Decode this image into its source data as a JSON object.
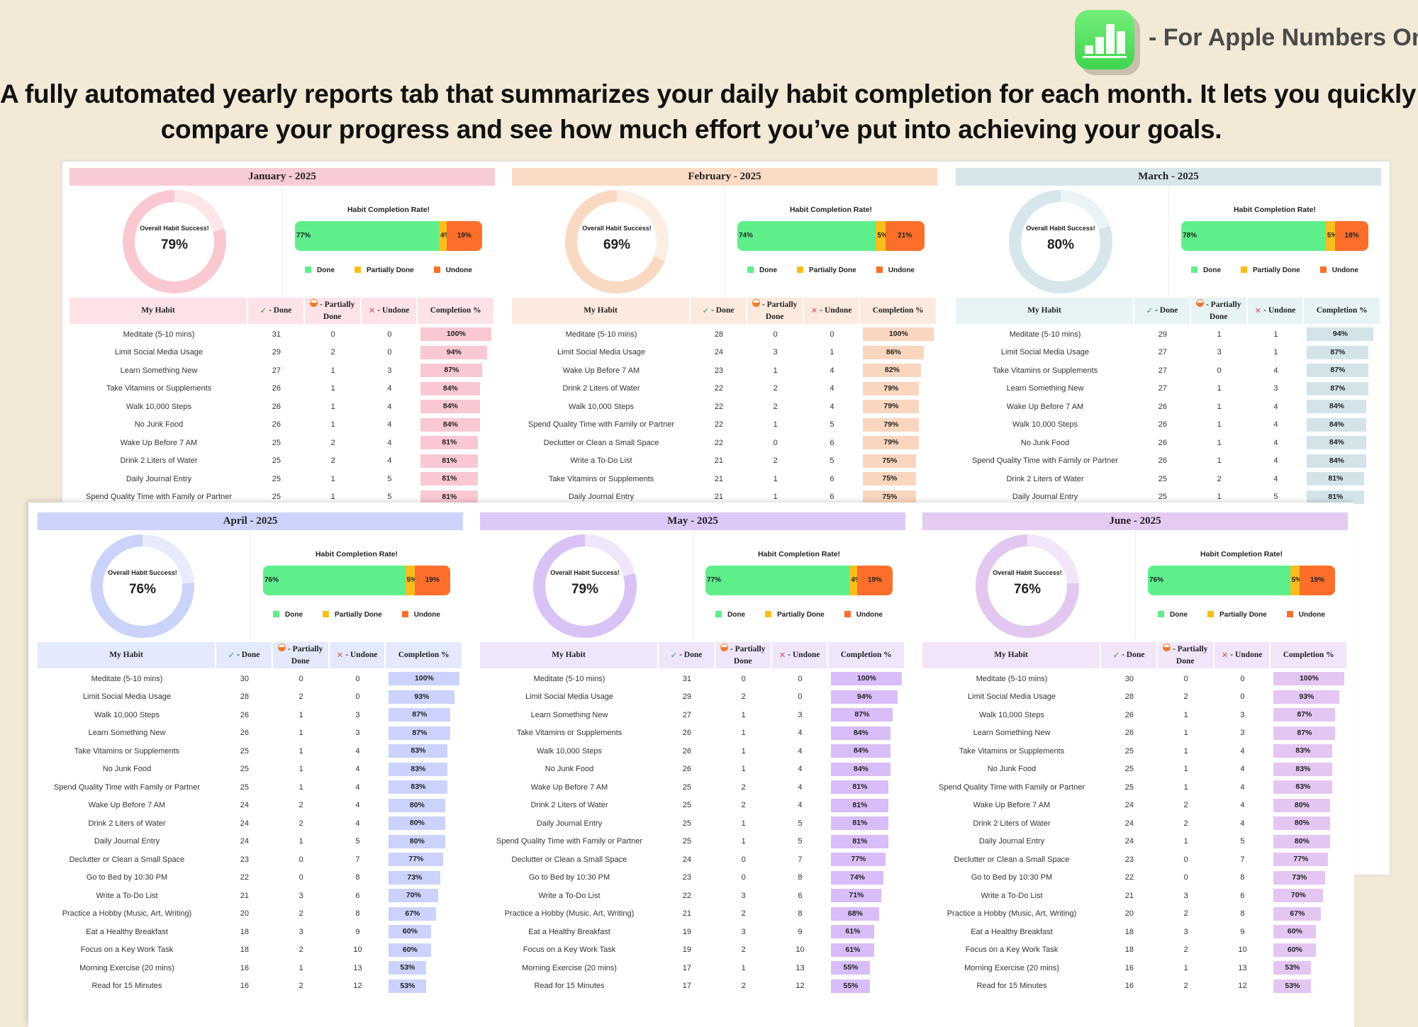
{
  "brand": {
    "icon": "apple-numbers-icon",
    "tagline": "- For Apple Numbers Only"
  },
  "headline": {
    "line1": "A fully automated yearly reports tab that summarizes your daily habit completion for each month. It lets you quickly",
    "line2": "compare your progress and see how much effort you’ve put into achieving your goals."
  },
  "labels": {
    "overall": "Overall Habit Success!",
    "rate_title": "Habit Completion Rate!",
    "legend_done": "Done",
    "legend_partial": "Partially Done",
    "legend_undone": "Undone",
    "col_habit": "My Habit",
    "col_done": "- Done",
    "col_partial": "- Partially Done",
    "col_undone": "- Undone",
    "col_completion": "Completion %"
  },
  "colors": {
    "done": "#5eef8b",
    "partial": "#f8be1c",
    "undone": "#fb6f2b"
  },
  "months": [
    {
      "title": "January - 2025",
      "overall": "79%",
      "done": "77%",
      "partial": "4%",
      "undone": "19%",
      "theme": {
        "head": "#f9ccd5",
        "th": "#fde3e8",
        "bar": "#f9c8d2",
        "ring": "#f9c8d1",
        "ring_light": "#fde6ea"
      },
      "rows": [
        {
          "habit": "Meditate (5-10 mins)",
          "done": "31",
          "partial": "0",
          "undone": "0",
          "pct": "100%"
        },
        {
          "habit": "Limit Social Media Usage",
          "done": "29",
          "partial": "2",
          "undone": "0",
          "pct": "94%"
        },
        {
          "habit": "Learn Something New",
          "done": "27",
          "partial": "1",
          "undone": "3",
          "pct": "87%"
        },
        {
          "habit": "Take Vitamins or Supplements",
          "done": "26",
          "partial": "1",
          "undone": "4",
          "pct": "84%"
        },
        {
          "habit": "Walk 10,000 Steps",
          "done": "26",
          "partial": "1",
          "undone": "4",
          "pct": "84%"
        },
        {
          "habit": "No Junk Food",
          "done": "26",
          "partial": "1",
          "undone": "4",
          "pct": "84%"
        },
        {
          "habit": "Wake Up Before 7 AM",
          "done": "25",
          "partial": "2",
          "undone": "4",
          "pct": "81%"
        },
        {
          "habit": "Drink 2 Liters of Water",
          "done": "25",
          "partial": "2",
          "undone": "4",
          "pct": "81%"
        },
        {
          "habit": "Daily Journal Entry",
          "done": "25",
          "partial": "1",
          "undone": "5",
          "pct": "81%"
        },
        {
          "habit": "Spend Quality Time with Family or Partner",
          "done": "25",
          "partial": "1",
          "undone": "5",
          "pct": "81%"
        }
      ]
    },
    {
      "title": "February - 2025",
      "overall": "69%",
      "done": "74%",
      "partial": "5%",
      "undone": "21%",
      "theme": {
        "head": "#fbdbc6",
        "th": "#fdeadf",
        "bar": "#fad6bf",
        "ring": "#fad9c3",
        "ring_light": "#fdeee4"
      },
      "rows": [
        {
          "habit": "Meditate (5-10 mins)",
          "done": "28",
          "partial": "0",
          "undone": "0",
          "pct": "100%"
        },
        {
          "habit": "Limit Social Media Usage",
          "done": "24",
          "partial": "3",
          "undone": "1",
          "pct": "86%"
        },
        {
          "habit": "Wake Up Before 7 AM",
          "done": "23",
          "partial": "1",
          "undone": "4",
          "pct": "82%"
        },
        {
          "habit": "Drink 2 Liters of Water",
          "done": "22",
          "partial": "2",
          "undone": "4",
          "pct": "79%"
        },
        {
          "habit": "Walk 10,000 Steps",
          "done": "22",
          "partial": "2",
          "undone": "4",
          "pct": "79%"
        },
        {
          "habit": "Spend Quality Time with Family or Partner",
          "done": "22",
          "partial": "1",
          "undone": "5",
          "pct": "79%"
        },
        {
          "habit": "Declutter or Clean a Small Space",
          "done": "22",
          "partial": "0",
          "undone": "6",
          "pct": "79%"
        },
        {
          "habit": "Write a To-Do List",
          "done": "21",
          "partial": "2",
          "undone": "5",
          "pct": "75%"
        },
        {
          "habit": "Take Vitamins or Supplements",
          "done": "21",
          "partial": "1",
          "undone": "6",
          "pct": "75%"
        },
        {
          "habit": "Daily Journal Entry",
          "done": "21",
          "partial": "1",
          "undone": "6",
          "pct": "75%"
        }
      ]
    },
    {
      "title": "March - 2025",
      "overall": "80%",
      "done": "78%",
      "partial": "5%",
      "undone": "18%",
      "theme": {
        "head": "#d7e6eb",
        "th": "#e8f3f6",
        "bar": "#d3e4e9",
        "ring": "#d6e6eb",
        "ring_light": "#eaf4f6"
      },
      "rows": [
        {
          "habit": "Meditate (5-10 mins)",
          "done": "29",
          "partial": "1",
          "undone": "1",
          "pct": "94%"
        },
        {
          "habit": "Limit Social Media Usage",
          "done": "27",
          "partial": "3",
          "undone": "1",
          "pct": "87%"
        },
        {
          "habit": "Take Vitamins or Supplements",
          "done": "27",
          "partial": "0",
          "undone": "4",
          "pct": "87%"
        },
        {
          "habit": "Learn Something New",
          "done": "27",
          "partial": "1",
          "undone": "3",
          "pct": "87%"
        },
        {
          "habit": "Wake Up Before 7 AM",
          "done": "26",
          "partial": "1",
          "undone": "4",
          "pct": "84%"
        },
        {
          "habit": "Walk 10,000 Steps",
          "done": "26",
          "partial": "1",
          "undone": "4",
          "pct": "84%"
        },
        {
          "habit": "No Junk Food",
          "done": "26",
          "partial": "1",
          "undone": "4",
          "pct": "84%"
        },
        {
          "habit": "Spend Quality Time with Family or Partner",
          "done": "26",
          "partial": "1",
          "undone": "4",
          "pct": "84%"
        },
        {
          "habit": "Drink 2 Liters of Water",
          "done": "25",
          "partial": "2",
          "undone": "4",
          "pct": "81%"
        },
        {
          "habit": "Daily Journal Entry",
          "done": "25",
          "partial": "1",
          "undone": "5",
          "pct": "81%"
        }
      ]
    },
    {
      "title": "April - 2025",
      "overall": "76%",
      "done": "76%",
      "partial": "5%",
      "undone": "19%",
      "theme": {
        "head": "#cdd3fb",
        "th": "#e5e9fd",
        "bar": "#ccd2fb",
        "ring": "#ccd3fa",
        "ring_light": "#e8ebfd"
      },
      "rows": [
        {
          "habit": "Meditate (5-10 mins)",
          "done": "30",
          "partial": "0",
          "undone": "0",
          "pct": "100%"
        },
        {
          "habit": "Limit Social Media Usage",
          "done": "28",
          "partial": "2",
          "undone": "0",
          "pct": "93%"
        },
        {
          "habit": "Walk 10,000 Steps",
          "done": "26",
          "partial": "1",
          "undone": "3",
          "pct": "87%"
        },
        {
          "habit": "Learn Something New",
          "done": "26",
          "partial": "1",
          "undone": "3",
          "pct": "87%"
        },
        {
          "habit": "Take Vitamins or Supplements",
          "done": "25",
          "partial": "1",
          "undone": "4",
          "pct": "83%"
        },
        {
          "habit": "No Junk Food",
          "done": "25",
          "partial": "1",
          "undone": "4",
          "pct": "83%"
        },
        {
          "habit": "Spend Quality Time with Family or Partner",
          "done": "25",
          "partial": "1",
          "undone": "4",
          "pct": "83%"
        },
        {
          "habit": "Wake Up Before 7 AM",
          "done": "24",
          "partial": "2",
          "undone": "4",
          "pct": "80%"
        },
        {
          "habit": "Drink 2 Liters of Water",
          "done": "24",
          "partial": "2",
          "undone": "4",
          "pct": "80%"
        },
        {
          "habit": "Daily Journal Entry",
          "done": "24",
          "partial": "1",
          "undone": "5",
          "pct": "80%"
        },
        {
          "habit": "Declutter or Clean a Small Space",
          "done": "23",
          "partial": "0",
          "undone": "7",
          "pct": "77%"
        },
        {
          "habit": "Go to Bed by 10:30 PM",
          "done": "22",
          "partial": "0",
          "undone": "8",
          "pct": "73%"
        },
        {
          "habit": "Write a To-Do List",
          "done": "21",
          "partial": "3",
          "undone": "6",
          "pct": "70%"
        },
        {
          "habit": "Practice a Hobby (Music, Art, Writing)",
          "done": "20",
          "partial": "2",
          "undone": "8",
          "pct": "67%"
        },
        {
          "habit": "Eat a Healthy Breakfast",
          "done": "18",
          "partial": "3",
          "undone": "9",
          "pct": "60%"
        },
        {
          "habit": "Focus on a Key Work Task",
          "done": "18",
          "partial": "2",
          "undone": "10",
          "pct": "60%"
        },
        {
          "habit": "Morning Exercise (20 mins)",
          "done": "16",
          "partial": "1",
          "undone": "13",
          "pct": "53%"
        },
        {
          "habit": "Read for 15 Minutes",
          "done": "16",
          "partial": "2",
          "undone": "12",
          "pct": "53%"
        }
      ]
    },
    {
      "title": "May - 2025",
      "overall": "79%",
      "done": "77%",
      "partial": "4%",
      "undone": "19%",
      "theme": {
        "head": "#dcc9f8",
        "th": "#efe6fc",
        "bar": "#d8bdf8",
        "ring": "#d9c3f6",
        "ring_light": "#efe6fc"
      },
      "rows": [
        {
          "habit": "Meditate (5-10 mins)",
          "done": "31",
          "partial": "0",
          "undone": "0",
          "pct": "100%"
        },
        {
          "habit": "Limit Social Media Usage",
          "done": "29",
          "partial": "2",
          "undone": "0",
          "pct": "94%"
        },
        {
          "habit": "Learn Something New",
          "done": "27",
          "partial": "1",
          "undone": "3",
          "pct": "87%"
        },
        {
          "habit": "Take Vitamins or Supplements",
          "done": "26",
          "partial": "1",
          "undone": "4",
          "pct": "84%"
        },
        {
          "habit": "Walk 10,000 Steps",
          "done": "26",
          "partial": "1",
          "undone": "4",
          "pct": "84%"
        },
        {
          "habit": "No Junk Food",
          "done": "26",
          "partial": "1",
          "undone": "4",
          "pct": "84%"
        },
        {
          "habit": "Wake Up Before 7 AM",
          "done": "25",
          "partial": "2",
          "undone": "4",
          "pct": "81%"
        },
        {
          "habit": "Drink 2 Liters of Water",
          "done": "25",
          "partial": "2",
          "undone": "4",
          "pct": "81%"
        },
        {
          "habit": "Daily Journal Entry",
          "done": "25",
          "partial": "1",
          "undone": "5",
          "pct": "81%"
        },
        {
          "habit": "Spend Quality Time with Family or Partner",
          "done": "25",
          "partial": "1",
          "undone": "5",
          "pct": "81%"
        },
        {
          "habit": "Declutter or Clean a Small Space",
          "done": "24",
          "partial": "0",
          "undone": "7",
          "pct": "77%"
        },
        {
          "habit": "Go to Bed by 10:30 PM",
          "done": "23",
          "partial": "0",
          "undone": "8",
          "pct": "74%"
        },
        {
          "habit": "Write a To-Do List",
          "done": "22",
          "partial": "3",
          "undone": "6",
          "pct": "71%"
        },
        {
          "habit": "Practice a Hobby (Music, Art, Writing)",
          "done": "21",
          "partial": "2",
          "undone": "8",
          "pct": "68%"
        },
        {
          "habit": "Eat a Healthy Breakfast",
          "done": "19",
          "partial": "3",
          "undone": "9",
          "pct": "61%"
        },
        {
          "habit": "Focus on a Key Work Task",
          "done": "19",
          "partial": "2",
          "undone": "10",
          "pct": "61%"
        },
        {
          "habit": "Morning Exercise (20 mins)",
          "done": "17",
          "partial": "1",
          "undone": "13",
          "pct": "55%"
        },
        {
          "habit": "Read for 15 Minutes",
          "done": "17",
          "partial": "2",
          "undone": "12",
          "pct": "55%"
        }
      ]
    },
    {
      "title": "June - 2025",
      "overall": "76%",
      "done": "76%",
      "partial": "5%",
      "undone": "19%",
      "theme": {
        "head": "#e5cbf2",
        "th": "#f2e5f9",
        "bar": "#e3c6f2",
        "ring": "#e2c8f1",
        "ring_light": "#f2e7fa"
      },
      "rows": [
        {
          "habit": "Meditate (5-10 mins)",
          "done": "30",
          "partial": "0",
          "undone": "0",
          "pct": "100%"
        },
        {
          "habit": "Limit Social Media Usage",
          "done": "28",
          "partial": "2",
          "undone": "0",
          "pct": "93%"
        },
        {
          "habit": "Walk 10,000 Steps",
          "done": "26",
          "partial": "1",
          "undone": "3",
          "pct": "87%"
        },
        {
          "habit": "Learn Something New",
          "done": "26",
          "partial": "1",
          "undone": "3",
          "pct": "87%"
        },
        {
          "habit": "Take Vitamins or Supplements",
          "done": "25",
          "partial": "1",
          "undone": "4",
          "pct": "83%"
        },
        {
          "habit": "No Junk Food",
          "done": "25",
          "partial": "1",
          "undone": "4",
          "pct": "83%"
        },
        {
          "habit": "Spend Quality Time with Family or Partner",
          "done": "25",
          "partial": "1",
          "undone": "4",
          "pct": "83%"
        },
        {
          "habit": "Wake Up Before 7 AM",
          "done": "24",
          "partial": "2",
          "undone": "4",
          "pct": "80%"
        },
        {
          "habit": "Drink 2 Liters of Water",
          "done": "24",
          "partial": "2",
          "undone": "4",
          "pct": "80%"
        },
        {
          "habit": "Daily Journal Entry",
          "done": "24",
          "partial": "1",
          "undone": "5",
          "pct": "80%"
        },
        {
          "habit": "Declutter or Clean a Small Space",
          "done": "23",
          "partial": "0",
          "undone": "7",
          "pct": "77%"
        },
        {
          "habit": "Go to Bed by 10:30 PM",
          "done": "22",
          "partial": "0",
          "undone": "8",
          "pct": "73%"
        },
        {
          "habit": "Write a To-Do List",
          "done": "21",
          "partial": "3",
          "undone": "6",
          "pct": "70%"
        },
        {
          "habit": "Practice a Hobby (Music, Art, Writing)",
          "done": "20",
          "partial": "2",
          "undone": "8",
          "pct": "67%"
        },
        {
          "habit": "Eat a Healthy Breakfast",
          "done": "18",
          "partial": "3",
          "undone": "9",
          "pct": "60%"
        },
        {
          "habit": "Focus on a Key Work Task",
          "done": "18",
          "partial": "2",
          "undone": "10",
          "pct": "60%"
        },
        {
          "habit": "Morning Exercise (20 mins)",
          "done": "16",
          "partial": "1",
          "undone": "13",
          "pct": "53%"
        },
        {
          "habit": "Read for 15 Minutes",
          "done": "16",
          "partial": "2",
          "undone": "12",
          "pct": "53%"
        }
      ]
    }
  ]
}
